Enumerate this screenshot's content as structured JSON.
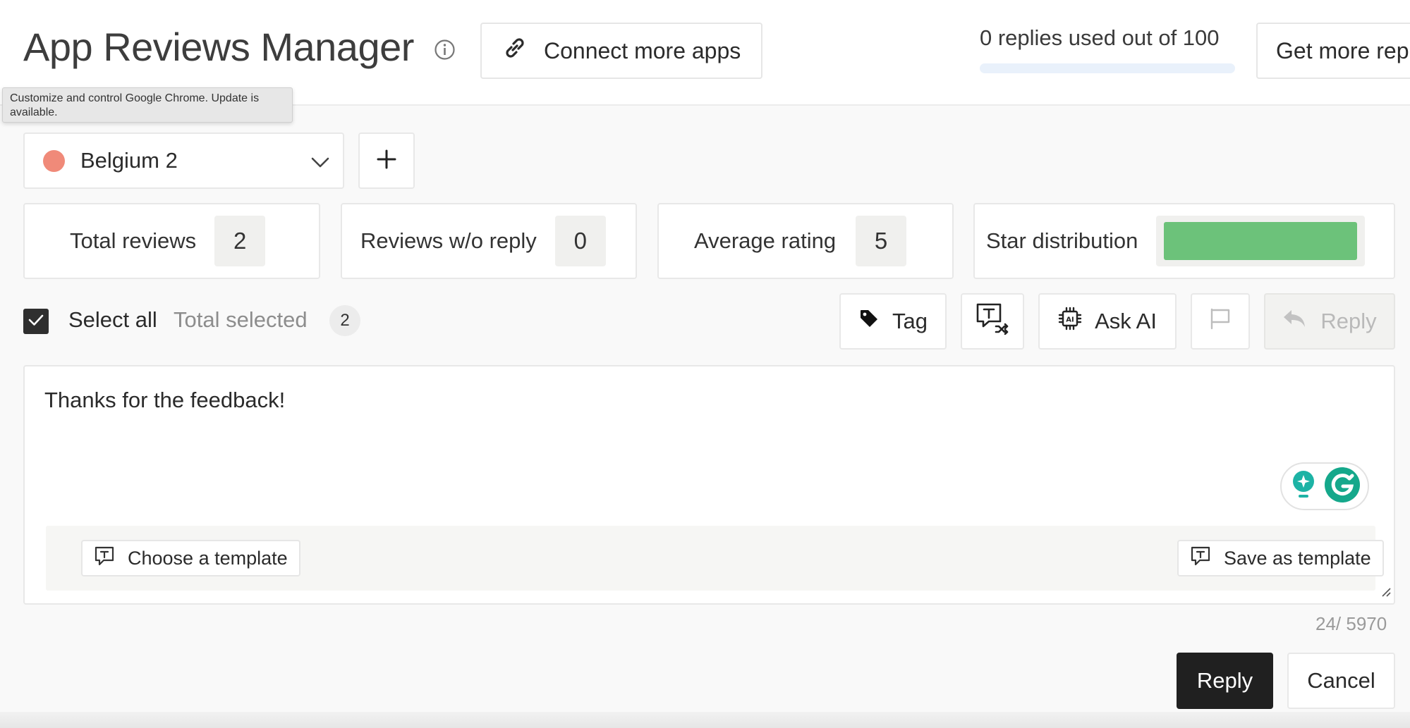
{
  "header": {
    "title": "App Reviews Manager",
    "connect_label": "Connect more apps",
    "usage_text": "0 replies used out of 100",
    "usage_fraction": 0,
    "get_more_label": "Get more rep"
  },
  "tooltip": {
    "text": "Customize and control Google Chrome. Update is available."
  },
  "store_selector": {
    "selected": "Belgium 2",
    "dot_color": "#f08a79"
  },
  "stats": {
    "total_reviews_label": "Total reviews",
    "total_reviews_value": "2",
    "no_reply_label": "Reviews w/o reply",
    "no_reply_value": "0",
    "avg_rating_label": "Average rating",
    "avg_rating_value": "5",
    "star_dist_label": "Star distribution",
    "star_dist_color": "#6cc27a"
  },
  "selection": {
    "select_all_label": "Select all",
    "select_all_checked": true,
    "total_selected_label": "Total selected",
    "total_selected_count": "2"
  },
  "toolbar": {
    "tag_label": "Tag",
    "ask_ai_label": "Ask AI",
    "reply_label": "Reply"
  },
  "editor": {
    "text": "Thanks for the feedback!",
    "choose_template_label": "Choose a template",
    "save_template_label": "Save as template",
    "char_count": "24/ 5970"
  },
  "actions": {
    "reply_label": "Reply",
    "cancel_label": "Cancel"
  },
  "icons": {
    "info": "info-icon",
    "link": "link-icon",
    "chevron": "chevron-down-icon",
    "plus": "plus-icon",
    "check": "check-icon",
    "tag": "tag-icon",
    "translate": "translate-icon",
    "ai_chip": "ai-chip-icon",
    "flag": "flag-icon",
    "reply_arrow": "reply-arrow-icon",
    "template": "template-icon",
    "grammarly": "grammarly-icon"
  }
}
